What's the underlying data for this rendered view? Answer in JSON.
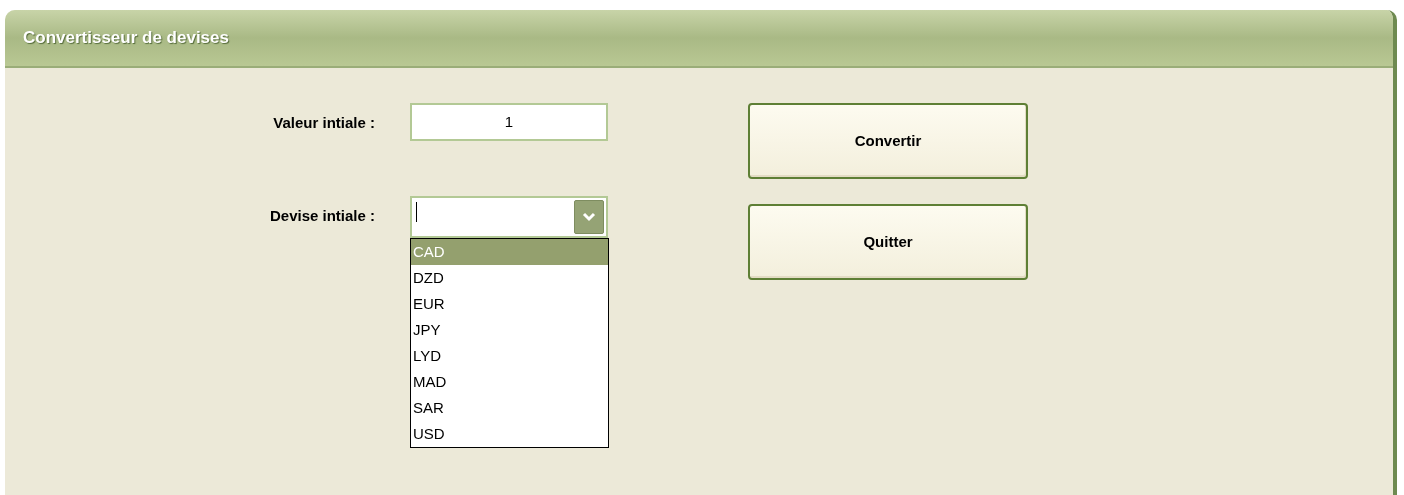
{
  "window": {
    "title": "Convertisseur de devises"
  },
  "fields": [
    {
      "label": "Valeur intiale :",
      "kind": "text",
      "value": "1"
    },
    {
      "label": "Devise intiale :",
      "kind": "combo",
      "expanded": true,
      "options": [
        {
          "label": "CAD",
          "selected": true
        },
        {
          "label": "DZD",
          "selected": false
        },
        {
          "label": "EUR",
          "selected": false
        },
        {
          "label": "JPY",
          "selected": false
        },
        {
          "label": "LYD",
          "selected": false
        },
        {
          "label": "MAD",
          "selected": false
        },
        {
          "label": "SAR",
          "selected": false
        },
        {
          "label": "USD",
          "selected": false
        }
      ]
    }
  ],
  "buttons": [
    "Convertir",
    "Quitter"
  ]
}
